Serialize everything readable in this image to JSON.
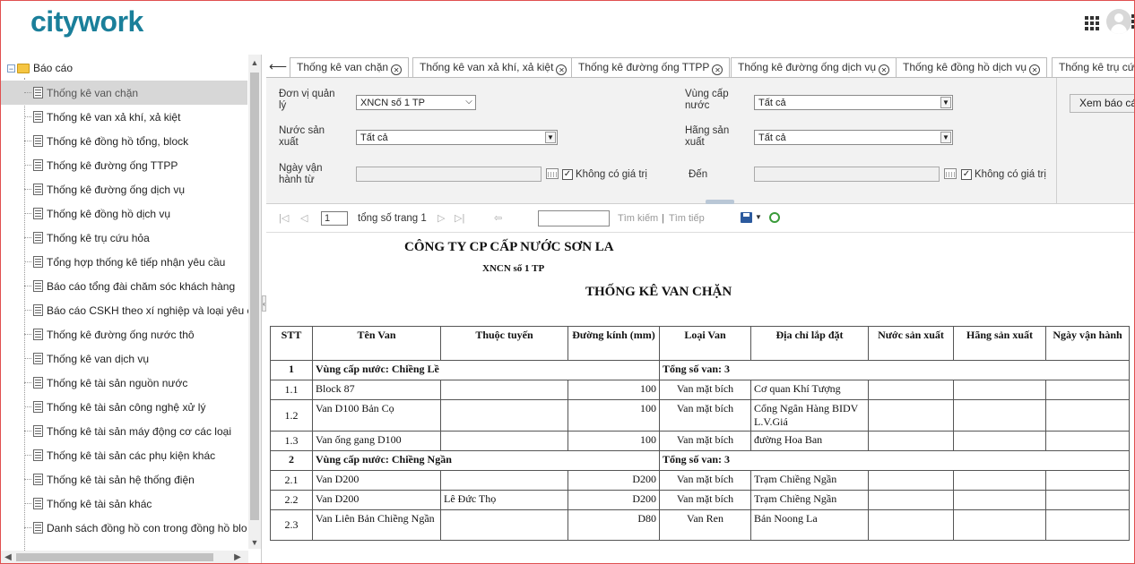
{
  "app": {
    "logo_text": "citywork"
  },
  "header": {
    "apps_icon": "grid-icon",
    "user_icon": "user-avatar-icon",
    "more_icon": "more-vertical-icon"
  },
  "sidebar": {
    "root_label": "Báo cáo",
    "items": [
      {
        "label": "Thống kê van chặn",
        "selected": true
      },
      {
        "label": "Thống kê van xả khí, xả kiệt"
      },
      {
        "label": "Thống kê đồng hồ tổng, block"
      },
      {
        "label": "Thống kê đường ống TTPP"
      },
      {
        "label": "Thống kê đường ống dịch vụ"
      },
      {
        "label": "Thống kê đồng hồ dịch vụ"
      },
      {
        "label": "Thống kê trụ cứu hỏa"
      },
      {
        "label": "Tổng hợp thống kê tiếp nhận yêu cầu"
      },
      {
        "label": "Báo cáo tổng đài chăm sóc khách hàng"
      },
      {
        "label": "Báo cáo CSKH theo xí nghiệp và loại yêu c"
      },
      {
        "label": "Thống kê đường ống nước thô"
      },
      {
        "label": "Thống kê van dịch vụ"
      },
      {
        "label": "Thống kê tài sản nguồn nước"
      },
      {
        "label": "Thống kê tài sản công nghệ xử lý"
      },
      {
        "label": "Thống kê tài sản máy động cơ các loại"
      },
      {
        "label": "Thống kê tài sản các phụ kiện khác"
      },
      {
        "label": "Thống kê tài sản hệ thống điện"
      },
      {
        "label": "Thống kê tài sản khác"
      },
      {
        "label": "Danh sách đồng hồ con trong đồng hồ blo"
      }
    ]
  },
  "tabs": [
    {
      "label": "Thống kê van chặn",
      "active": true
    },
    {
      "label": "Thống kê van xả khí, xả kiệt"
    },
    {
      "label": "Thống kê đường ống TTPP"
    },
    {
      "label": "Thống kê đường ống dịch vụ"
    },
    {
      "label": "Thống kê đồng hồ dịch vụ"
    },
    {
      "label": "Thống kê trụ cứu"
    }
  ],
  "filters": {
    "don_vi_label": "Đơn vị quản lý",
    "don_vi_value": "XNCN số 1 TP",
    "vung_label": "Vùng cấp nước",
    "vung_value": "Tất cả",
    "nuoc_sx_label": "Nước sản xuất",
    "nuoc_sx_value": "Tất cả",
    "hang_sx_label": "Hãng sản xuất",
    "hang_sx_value": "Tất cả",
    "ngay_label": "Ngày vận hành từ",
    "den_label": "Đến",
    "no_value_label": "Không có giá trị",
    "view_button": "Xem báo cáo"
  },
  "toolbar": {
    "page_value": "1",
    "total_pages": "tổng số trang 1",
    "search_link": "Tìm kiếm",
    "separator": "|",
    "next_link": "Tìm tiếp"
  },
  "report": {
    "company": "CÔNG TY CP CẤP NƯỚC SƠN LA",
    "unit": "XNCN số 1 TP",
    "title": "THỐNG KÊ VAN CHẶN",
    "columns": [
      "STT",
      "Tên Van",
      "Thuộc tuyến",
      "Đường kính (mm)",
      "Loại Van",
      "Địa chỉ lắp đặt",
      "Nước sản xuất",
      "Hãng sản xuất",
      "Ngày vận hành"
    ],
    "group1": {
      "stt": "1",
      "name": "Vùng cấp nước: Chiềng Lề",
      "total": "Tổng số van: 3"
    },
    "group1_rows": [
      {
        "stt": "1.1",
        "ten": "Block 87",
        "tuyen": "",
        "dk": "100",
        "loai": "Van mặt bích",
        "diachi": "Cơ quan Khí Tượng"
      },
      {
        "stt": "1.2",
        "ten": "Van D100 Bản Cọ",
        "tuyen": "",
        "dk": "100",
        "loai": "Van mặt bích",
        "diachi": "Cổng Ngân Hàng BIDV L.V.Giá"
      },
      {
        "stt": "1.3",
        "ten": "Van ống gang D100",
        "tuyen": "",
        "dk": "100",
        "loai": "Van mặt bích",
        "diachi": "đường Hoa Ban"
      }
    ],
    "group2": {
      "stt": "2",
      "name": "Vùng cấp nước: Chiềng Ngần",
      "total": "Tổng số van: 3"
    },
    "group2_rows": [
      {
        "stt": "2.1",
        "ten": "Van D200",
        "tuyen": "",
        "dk": "D200",
        "loai": "Van mặt bích",
        "diachi": "Trạm Chiềng Ngần"
      },
      {
        "stt": "2.2",
        "ten": "Van D200",
        "tuyen": "Lê Đức Thọ",
        "dk": "D200",
        "loai": "Van mặt bích",
        "diachi": "Trạm Chiềng Ngần"
      },
      {
        "stt": "2.3",
        "ten": "Van Liên Bản Chiềng Ngần",
        "tuyen": "",
        "dk": "D80",
        "loai": "Van Ren",
        "diachi": "Bản Noong La"
      }
    ]
  },
  "colors": {
    "brand": "#1a7f9a",
    "selected_bg": "#d7d7d7",
    "filter_bg": "#f2f2f2"
  }
}
